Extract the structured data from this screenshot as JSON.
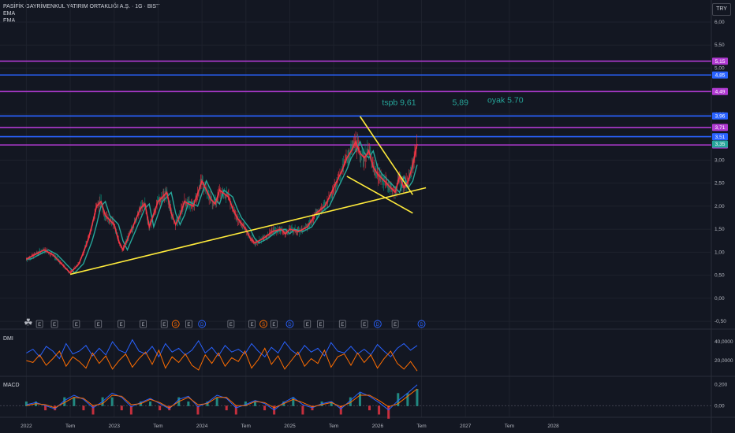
{
  "header": {
    "title": "PASİFİK GAYRİMENKUL YATIRIM ORTAKLIĞI A.Ş. · 1G · BIST",
    "indicators": [
      "EMA",
      "EMA"
    ],
    "currency": "TRY"
  },
  "colors": {
    "background": "#131722",
    "purple": "#b03ad1",
    "blue": "#2962ff",
    "trendline": "#ffeb3b",
    "ema_fast": "#f23645",
    "ema_slow": "#26a69a",
    "annotation": "#26a69a",
    "dmi_plus": "#2962ff",
    "dmi_minus": "#ff6d00"
  },
  "chart_data": [
    {
      "type": "line",
      "pane": "price",
      "y_ticks": [
        "6,00",
        "5,50",
        "5,00",
        "4,50",
        "4,00",
        "3,50",
        "3,00",
        "2,50",
        "2,00",
        "1,50",
        "1,00",
        "0,50",
        "0,00",
        "-0,50"
      ],
      "ylim": [
        -0.55,
        6.0
      ],
      "x_ticks": [
        "2022",
        "Tem",
        "2023",
        "Tem",
        "2024",
        "Tem",
        "2025",
        "Tem",
        "2026",
        "Tem",
        "2027",
        "Tem",
        "2028"
      ],
      "x_tick_positions": [
        2022.0,
        2022.5,
        2023.0,
        2023.5,
        2024.0,
        2024.5,
        2025.0,
        2025.5,
        2026.0,
        2026.5,
        2027.0,
        2027.5,
        2028.0
      ],
      "xlim": [
        2021.7,
        2029.8
      ],
      "horizontal_levels": [
        {
          "value": 5.15,
          "color": "purple",
          "label": "5,15"
        },
        {
          "value": 4.85,
          "color": "blue",
          "label": "4,85"
        },
        {
          "value": 4.49,
          "color": "purple",
          "label": "4,49"
        },
        {
          "value": 3.96,
          "color": "blue",
          "label": "3,96"
        },
        {
          "value": 3.71,
          "color": "purple",
          "label": "3,71"
        },
        {
          "value": 3.51,
          "color": "blue",
          "label": "3,51"
        },
        {
          "value": 3.33,
          "color": "purple",
          "label": "3,33"
        }
      ],
      "last_price": {
        "value": 3.35,
        "label": "3,35"
      },
      "trendlines": [
        {
          "x": [
            2022.5,
            2026.55
          ],
          "y": [
            0.52,
            2.4
          ]
        },
        {
          "x": [
            2025.8,
            2026.4
          ],
          "y": [
            3.95,
            2.25
          ]
        },
        {
          "x": [
            2025.65,
            2026.4
          ],
          "y": [
            2.65,
            1.85
          ]
        }
      ],
      "series": [
        {
          "x": [
            2022.0,
            2022.1,
            2022.2,
            2022.3,
            2022.4,
            2022.5,
            2022.6,
            2022.7,
            2022.75,
            2022.8,
            2022.85,
            2022.9,
            2023.0,
            2023.05,
            2023.1,
            2023.2,
            2023.3,
            2023.35,
            2023.4,
            2023.5,
            2023.6,
            2023.65,
            2023.7,
            2023.75,
            2023.8,
            2023.9,
            2024.0,
            2024.1,
            2024.15,
            2024.2,
            2024.3,
            2024.35,
            2024.4,
            2024.5,
            2024.55,
            2024.6,
            2024.7,
            2024.8,
            2024.9,
            2024.95,
            2025.0,
            2025.1,
            2025.2,
            2025.3,
            2025.4,
            2025.5,
            2025.6,
            2025.65,
            2025.7,
            2025.75,
            2025.8,
            2025.85,
            2025.9,
            2025.95,
            2026.0,
            2026.1,
            2026.2,
            2026.25,
            2026.3,
            2026.35,
            2026.4,
            2026.45
          ],
          "values": [
            0.85,
            0.95,
            1.05,
            0.95,
            0.75,
            0.55,
            0.75,
            1.25,
            1.6,
            2.0,
            2.1,
            1.8,
            1.6,
            1.25,
            1.05,
            1.5,
            1.95,
            2.05,
            1.55,
            2.1,
            2.3,
            1.85,
            1.6,
            1.8,
            2.1,
            2.0,
            2.55,
            2.15,
            2.05,
            2.35,
            2.2,
            1.95,
            1.75,
            1.5,
            1.3,
            1.2,
            1.3,
            1.45,
            1.5,
            1.4,
            1.5,
            1.45,
            1.55,
            1.85,
            2.0,
            2.4,
            2.8,
            3.05,
            3.2,
            3.4,
            3.15,
            3.05,
            3.2,
            2.85,
            2.7,
            2.5,
            2.3,
            2.65,
            2.4,
            2.55,
            2.9,
            3.35
          ]
        }
      ]
    },
    {
      "type": "line",
      "pane": "dmi",
      "title": "DMI",
      "y_ticks": [
        "40,0000",
        "20,0000"
      ],
      "ylim": [
        5,
        50
      ],
      "series": [
        {
          "color": "dmi_plus",
          "values": [
            28,
            32,
            24,
            35,
            30,
            22,
            38,
            27,
            30,
            36,
            25,
            33,
            26,
            40,
            31,
            28,
            42,
            30,
            27,
            35,
            24,
            38,
            29,
            33,
            26,
            31,
            41,
            28,
            34,
            25,
            36,
            29,
            32,
            27,
            38,
            30,
            24,
            34,
            28,
            40,
            31,
            26,
            36,
            29,
            33,
            25,
            39,
            30,
            28,
            35,
            27,
            32,
            26,
            37,
            30,
            24,
            33,
            38,
            31,
            36
          ]
        },
        {
          "color": "dmi_minus",
          "values": [
            20,
            18,
            26,
            15,
            22,
            30,
            14,
            24,
            19,
            12,
            28,
            17,
            25,
            11,
            20,
            27,
            13,
            22,
            29,
            16,
            31,
            12,
            24,
            18,
            27,
            15,
            10,
            26,
            17,
            28,
            14,
            23,
            19,
            30,
            12,
            21,
            33,
            16,
            25,
            11,
            20,
            29,
            14,
            22,
            17,
            31,
            13,
            24,
            27,
            15,
            28,
            18,
            26,
            12,
            22,
            30,
            17,
            11,
            19,
            9
          ]
        }
      ]
    },
    {
      "type": "line",
      "pane": "macd",
      "title": "MACD",
      "y_ticks": [
        "0,200",
        "0,00"
      ],
      "ylim": [
        -0.08,
        0.25
      ],
      "series": [
        {
          "color": "dmi_plus",
          "values": [
            0.01,
            0.03,
            0.0,
            -0.03,
            0.05,
            0.1,
            0.06,
            -0.02,
            0.04,
            0.12,
            0.08,
            -0.01,
            0.03,
            0.07,
            0.02,
            -0.03,
            0.06,
            0.09,
            -0.01,
            0.03,
            0.1,
            0.07,
            -0.02,
            0.01,
            0.05,
            0.02,
            -0.04,
            0.03,
            0.08,
            0.01,
            -0.02,
            0.02,
            0.04,
            -0.03,
            0.05,
            0.13,
            0.09,
            0.03,
            -0.04,
            0.05,
            0.12,
            0.2
          ]
        },
        {
          "color": "dmi_minus",
          "values": [
            0.0,
            0.02,
            0.01,
            -0.02,
            0.03,
            0.08,
            0.07,
            0.0,
            0.02,
            0.1,
            0.09,
            0.01,
            0.02,
            0.06,
            0.03,
            -0.02,
            0.04,
            0.08,
            0.01,
            0.02,
            0.08,
            0.08,
            0.0,
            0.0,
            0.04,
            0.03,
            -0.02,
            0.02,
            0.06,
            0.03,
            -0.01,
            0.01,
            0.03,
            -0.01,
            0.03,
            0.1,
            0.1,
            0.05,
            -0.01,
            0.02,
            0.09,
            0.16
          ]
        }
      ]
    }
  ],
  "annotations": [
    {
      "text": "tspb 9,61",
      "x": 2026.05,
      "y": 4.2
    },
    {
      "text": "5,89",
      "x": 2026.85,
      "y": 4.2
    },
    {
      "text": "oyak 5.70",
      "x": 2027.25,
      "y": 4.25
    }
  ],
  "events": [
    {
      "text": "E",
      "x": 2022.15,
      "kind": "earn"
    },
    {
      "text": "E",
      "x": 2022.32,
      "kind": "earn"
    },
    {
      "text": "E",
      "x": 2022.57,
      "kind": "earn"
    },
    {
      "text": "E",
      "x": 2022.82,
      "kind": "earn"
    },
    {
      "text": "E",
      "x": 2023.08,
      "kind": "earn"
    },
    {
      "text": "E",
      "x": 2023.33,
      "kind": "earn"
    },
    {
      "text": "E",
      "x": 2023.57,
      "kind": "earn"
    },
    {
      "text": "S",
      "x": 2023.7,
      "kind": "split"
    },
    {
      "text": "E",
      "x": 2023.85,
      "kind": "earn"
    },
    {
      "text": "D",
      "x": 2024.0,
      "kind": "div"
    },
    {
      "text": "E",
      "x": 2024.33,
      "kind": "earn"
    },
    {
      "text": "E",
      "x": 2024.57,
      "kind": "earn"
    },
    {
      "text": "S",
      "x": 2024.7,
      "kind": "split"
    },
    {
      "text": "E",
      "x": 2024.82,
      "kind": "earn"
    },
    {
      "text": "D",
      "x": 2025.0,
      "kind": "div"
    },
    {
      "text": "E",
      "x": 2025.2,
      "kind": "earn"
    },
    {
      "text": "E",
      "x": 2025.35,
      "kind": "earn"
    },
    {
      "text": "E",
      "x": 2025.6,
      "kind": "earn"
    },
    {
      "text": "E",
      "x": 2025.85,
      "kind": "earn"
    },
    {
      "text": "D",
      "x": 2026.0,
      "kind": "div"
    },
    {
      "text": "E",
      "x": 2026.2,
      "kind": "earn"
    },
    {
      "text": "D",
      "x": 2026.5,
      "kind": "div"
    }
  ]
}
